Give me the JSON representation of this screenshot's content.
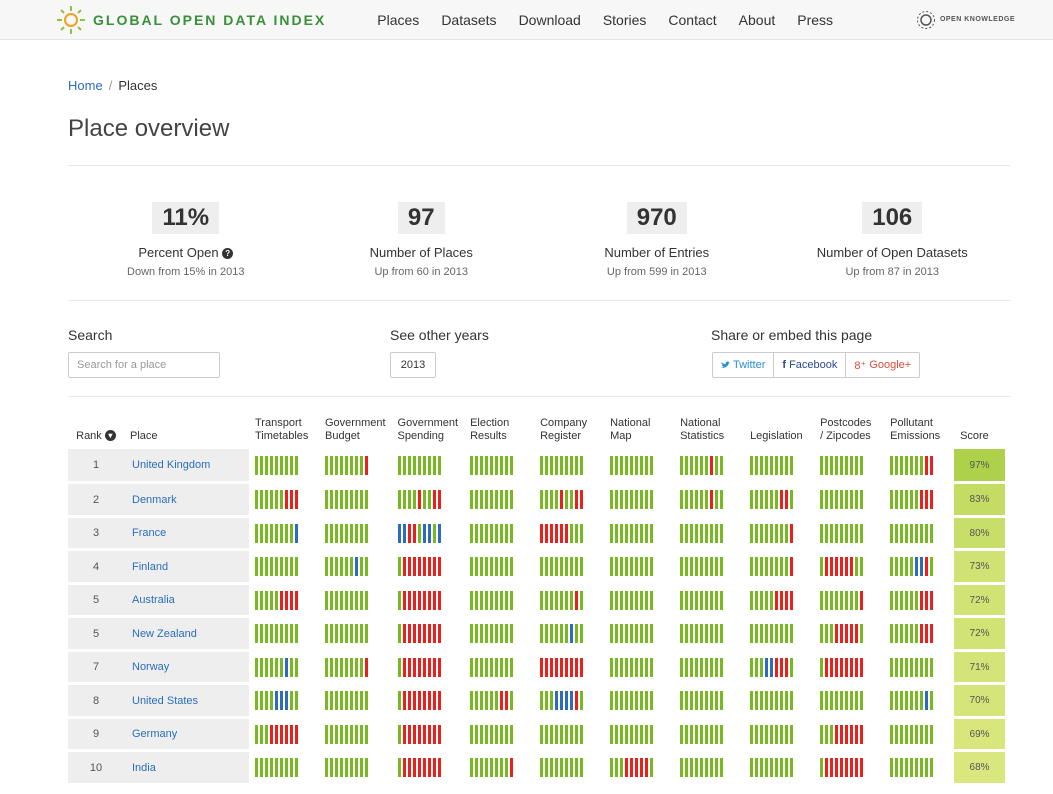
{
  "brand": {
    "name": "GLOBAL OPEN DATA INDEX",
    "partner": "OPEN KNOWLEDGE"
  },
  "nav": [
    "Places",
    "Datasets",
    "Download",
    "Stories",
    "Contact",
    "About",
    "Press"
  ],
  "breadcrumb": {
    "home": "Home",
    "sep": "/",
    "current": "Places"
  },
  "page_title": "Place overview",
  "stats": [
    {
      "value": "11%",
      "label": "Percent Open",
      "sub": "Down from 15% in 2013"
    },
    {
      "value": "97",
      "label": "Number of Places",
      "sub": "Up from 60 in 2013"
    },
    {
      "value": "970",
      "label": "Number of Entries",
      "sub": "Up from 599 in 2013"
    },
    {
      "value": "106",
      "label": "Number of Open Datasets",
      "sub": "Up from 87 in 2013"
    }
  ],
  "search": {
    "label": "Search",
    "placeholder": "Search for a place"
  },
  "years": {
    "label": "See other years",
    "selected": "2013"
  },
  "share": {
    "label": "Share or embed this page",
    "twitter": "Twitter",
    "facebook": "Facebook",
    "google": "Google+"
  },
  "table": {
    "rank_header": "Rank",
    "place_header": "Place",
    "score_header": "Score",
    "datasets": [
      [
        "Transport",
        "Timetables"
      ],
      [
        "Government",
        "Budget"
      ],
      [
        "Government",
        "Spending"
      ],
      [
        "Election",
        "Results"
      ],
      [
        "Company",
        "Register"
      ],
      [
        "National",
        "Map"
      ],
      [
        "National",
        "Statistics"
      ],
      [
        "",
        "Legislation"
      ],
      [
        "Postcodes",
        "/ Zipcodes"
      ],
      [
        "Pollutant",
        "Emissions"
      ]
    ],
    "colors": {
      "g": "#78b922",
      "r": "#e8211c",
      "b": "#2c6bbf"
    },
    "rows": [
      {
        "rank": "1",
        "place": "United Kingdom",
        "score": "97%",
        "score_color": "#aed14c",
        "cells": [
          "ggggggggg",
          "ggggggggr",
          "ggggggggg",
          "ggggggggg",
          "ggggggggg",
          "ggggggggg",
          "ggggggrgg",
          "ggggggggg",
          "ggggggggg",
          "gggggggrr"
        ]
      },
      {
        "rank": "2",
        "place": "Denmark",
        "score": "83%",
        "score_color": "#c4dc64",
        "cells": [
          "ggggggrrr",
          "ggggggggg",
          "ggggrggrr",
          "ggggggggg",
          "ggggrggrr",
          "ggggggggg",
          "ggggggrgg",
          "ggggggrrg",
          "ggggggggg",
          "ggggggrrr"
        ]
      },
      {
        "rank": "3",
        "place": "France",
        "score": "80%",
        "score_color": "#c8de6a",
        "cells": [
          "ggggggggb",
          "ggggggggg",
          "bbrrgbbgb",
          "ggggggggg",
          "rrrrrrggg",
          "ggggggggg",
          "ggggggggg",
          "ggggggggr",
          "ggggggggg",
          "ggggggggg"
        ]
      },
      {
        "rank": "4",
        "place": "Finland",
        "score": "73%",
        "score_color": "#d0e274",
        "cells": [
          "ggggggggg",
          "ggggggbgg",
          "grrrrrrrr",
          "ggggggggg",
          "ggggggggg",
          "ggggggggg",
          "ggggggggg",
          "ggggggggr",
          "grrrrrrgg",
          "gggggbbrg"
        ]
      },
      {
        "rank": "5",
        "place": "Australia",
        "score": "72%",
        "score_color": "#d2e376",
        "cells": [
          "gggggrrrr",
          "ggggggggg",
          "grrrrrrrr",
          "ggggggggg",
          "gggggggrg",
          "ggggggggg",
          "ggggggggg",
          "gggggrrrr",
          "ggggggggr",
          "ggggggrrr"
        ]
      },
      {
        "rank": "5",
        "place": "New Zealand",
        "score": "72%",
        "score_color": "#d2e376",
        "cells": [
          "ggggggggg",
          "ggggggggg",
          "grrrrrrrr",
          "ggggggggg",
          "ggggggbgg",
          "ggggggggg",
          "ggggggggg",
          "ggggggggg",
          "gggrrrrrg",
          "ggggggrrr"
        ]
      },
      {
        "rank": "7",
        "place": "Norway",
        "score": "71%",
        "score_color": "#d4e478",
        "cells": [
          "ggggggbgg",
          "ggggggggr",
          "grrrrrrrr",
          "ggggggggg",
          "rrrrrrrrr",
          "ggggggggg",
          "ggggggggg",
          "gggbbrrrg",
          "grrrrrrrr",
          "ggggggggg"
        ]
      },
      {
        "rank": "8",
        "place": "United States",
        "score": "70%",
        "score_color": "#d6e57a",
        "cells": [
          "ggggbbbgg",
          "ggggggggg",
          "grrrrrrrr",
          "ggggggrrg",
          "gggbbbbrg",
          "ggggggggg",
          "ggggggggg",
          "ggggggggg",
          "ggggggggg",
          "gggggggbg"
        ]
      },
      {
        "rank": "9",
        "place": "Germany",
        "score": "69%",
        "score_color": "#d8e67c",
        "cells": [
          "gggrrrrrr",
          "ggggggggg",
          "grrrrrrrr",
          "ggggggggg",
          "ggggggggg",
          "ggggggggg",
          "ggggggggg",
          "ggggggggg",
          "gggrrrrrr",
          "ggggggggg"
        ]
      },
      {
        "rank": "10",
        "place": "India",
        "score": "68%",
        "score_color": "#dae77e",
        "cells": [
          "ggggggggg",
          "ggggggggg",
          "grrrrrrrr",
          "ggggggggr",
          "ggggggggg",
          "gggrrrrrg",
          "ggggggggg",
          "ggggggggg",
          "grrrrrrrr",
          "ggggggggg"
        ]
      }
    ]
  }
}
